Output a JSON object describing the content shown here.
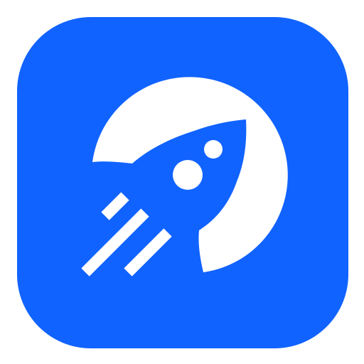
{
  "app_icon": {
    "icon": "rocket-launch-icon",
    "colors": {
      "background": "#1163FF",
      "foreground": "#FFFFFF"
    }
  }
}
